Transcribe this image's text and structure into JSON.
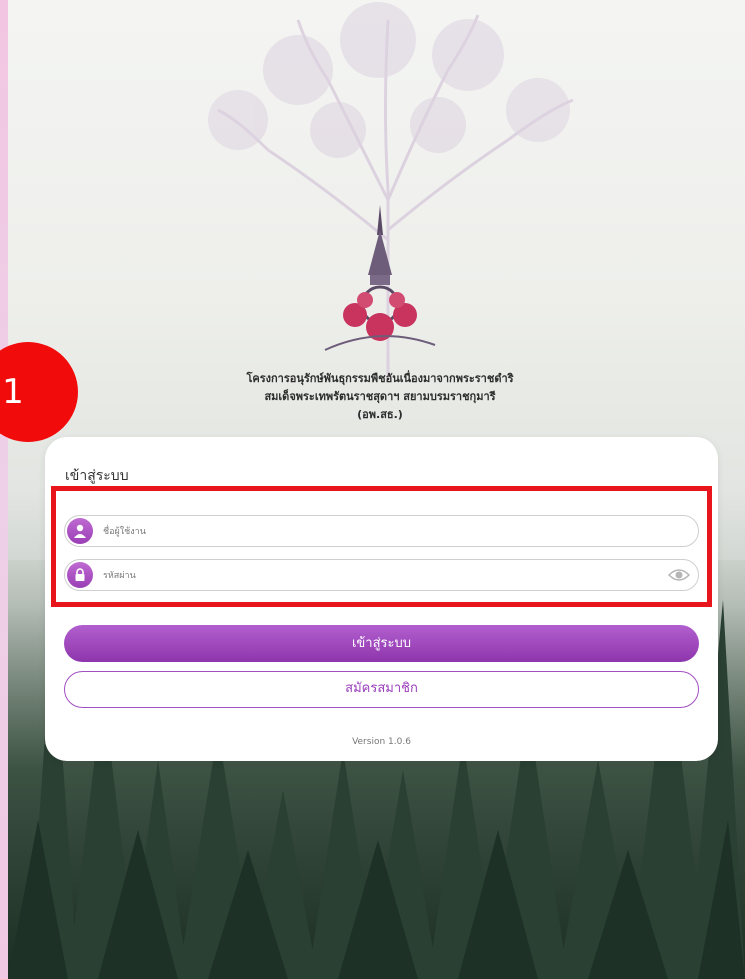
{
  "header": {
    "org_line1": "โครงการอนุรักษ์พันธุกรรมพืชอันเนื่องมาจากพระราชดำริ",
    "org_line2": "สมเด็จพระเทพรัตนราชสุดาฯ สยามบรมราชกุมารี",
    "org_line3": "(อพ.สธ.)",
    "logo_icon": "rspg-crest-icon"
  },
  "step_marker": {
    "number": "1",
    "color": "#f20b0b"
  },
  "login_card": {
    "heading": "เข้าสู่ระบบ",
    "username": {
      "placeholder": "ชื่อผู้ใช้งาน",
      "value": "",
      "icon": "user-icon"
    },
    "password": {
      "placeholder": "รหัสผ่าน",
      "value": "",
      "icon": "lock-icon",
      "toggle_icon": "eye-icon"
    },
    "login_label": "เข้าสู่ระบบ",
    "register_label": "สมัครสมาชิก",
    "version": "Version 1.0.6"
  },
  "colors": {
    "accent_purple": "#9b3fbb",
    "highlight_red": "#e8161c",
    "badge_red": "#f20b0b"
  }
}
